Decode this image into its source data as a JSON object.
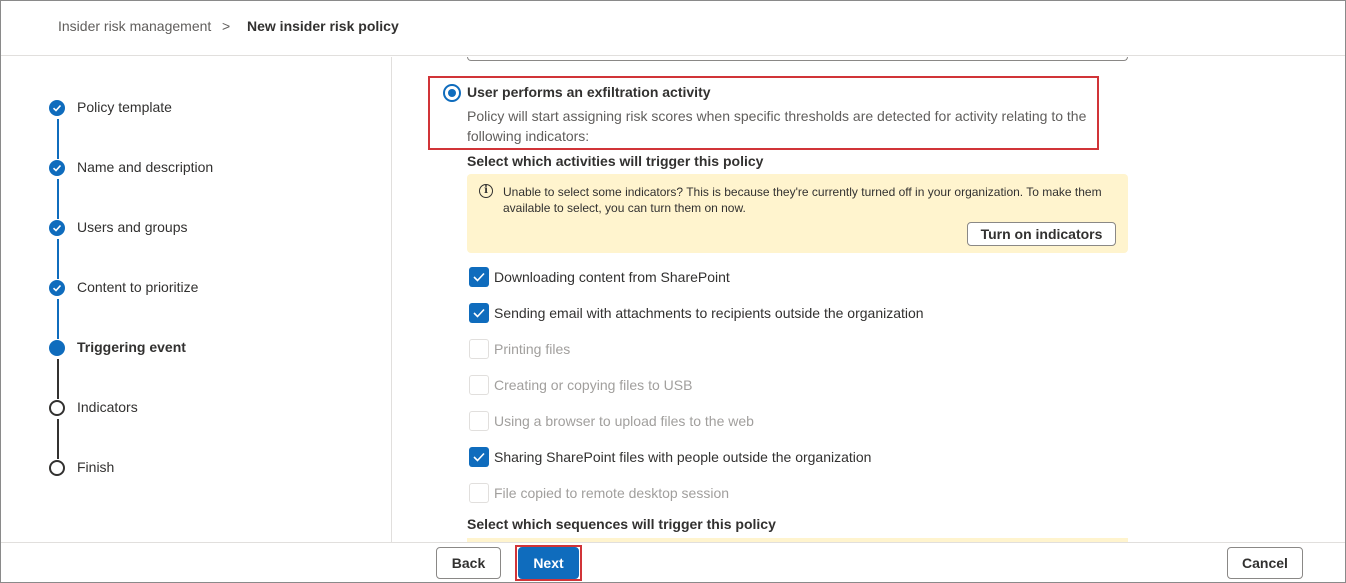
{
  "breadcrumb": {
    "root": "Insider risk management",
    "separator": ">",
    "current": "New insider risk policy"
  },
  "steps": [
    {
      "label": "Policy template",
      "state": "done"
    },
    {
      "label": "Name and description",
      "state": "done"
    },
    {
      "label": "Users and groups",
      "state": "done"
    },
    {
      "label": "Content to prioritize",
      "state": "done"
    },
    {
      "label": "Triggering event",
      "state": "active"
    },
    {
      "label": "Indicators",
      "state": "todo"
    },
    {
      "label": "Finish",
      "state": "todo"
    }
  ],
  "trigger": {
    "option_title": "User performs an exfiltration activity",
    "option_description": "Policy will start assigning risk scores when specific thresholds are detected for activity relating to the following indicators:",
    "selected": true
  },
  "activities": {
    "title": "Select which activities will trigger this policy",
    "banner_message": "Unable to select some indicators? This is because they're currently turned off in your organization. To make them available to select, you can turn them on now.",
    "banner_button": "Turn on indicators",
    "items": [
      {
        "label": "Downloading content from SharePoint",
        "checked": true,
        "enabled": true
      },
      {
        "label": "Sending email with attachments to recipients outside the organization",
        "checked": true,
        "enabled": true
      },
      {
        "label": "Printing files",
        "checked": false,
        "enabled": false
      },
      {
        "label": "Creating or copying files to USB",
        "checked": false,
        "enabled": false
      },
      {
        "label": "Using a browser to upload files to the web",
        "checked": false,
        "enabled": false
      },
      {
        "label": "Sharing SharePoint files with people outside the organization",
        "checked": true,
        "enabled": true
      },
      {
        "label": "File copied to remote desktop session",
        "checked": false,
        "enabled": false
      }
    ]
  },
  "sequences": {
    "title": "Select which sequences will trigger this policy"
  },
  "footer": {
    "back": "Back",
    "next": "Next",
    "cancel": "Cancel"
  },
  "colors": {
    "accent": "#0f6cbd",
    "highlight": "#d13438",
    "banner": "#fff4ce"
  }
}
